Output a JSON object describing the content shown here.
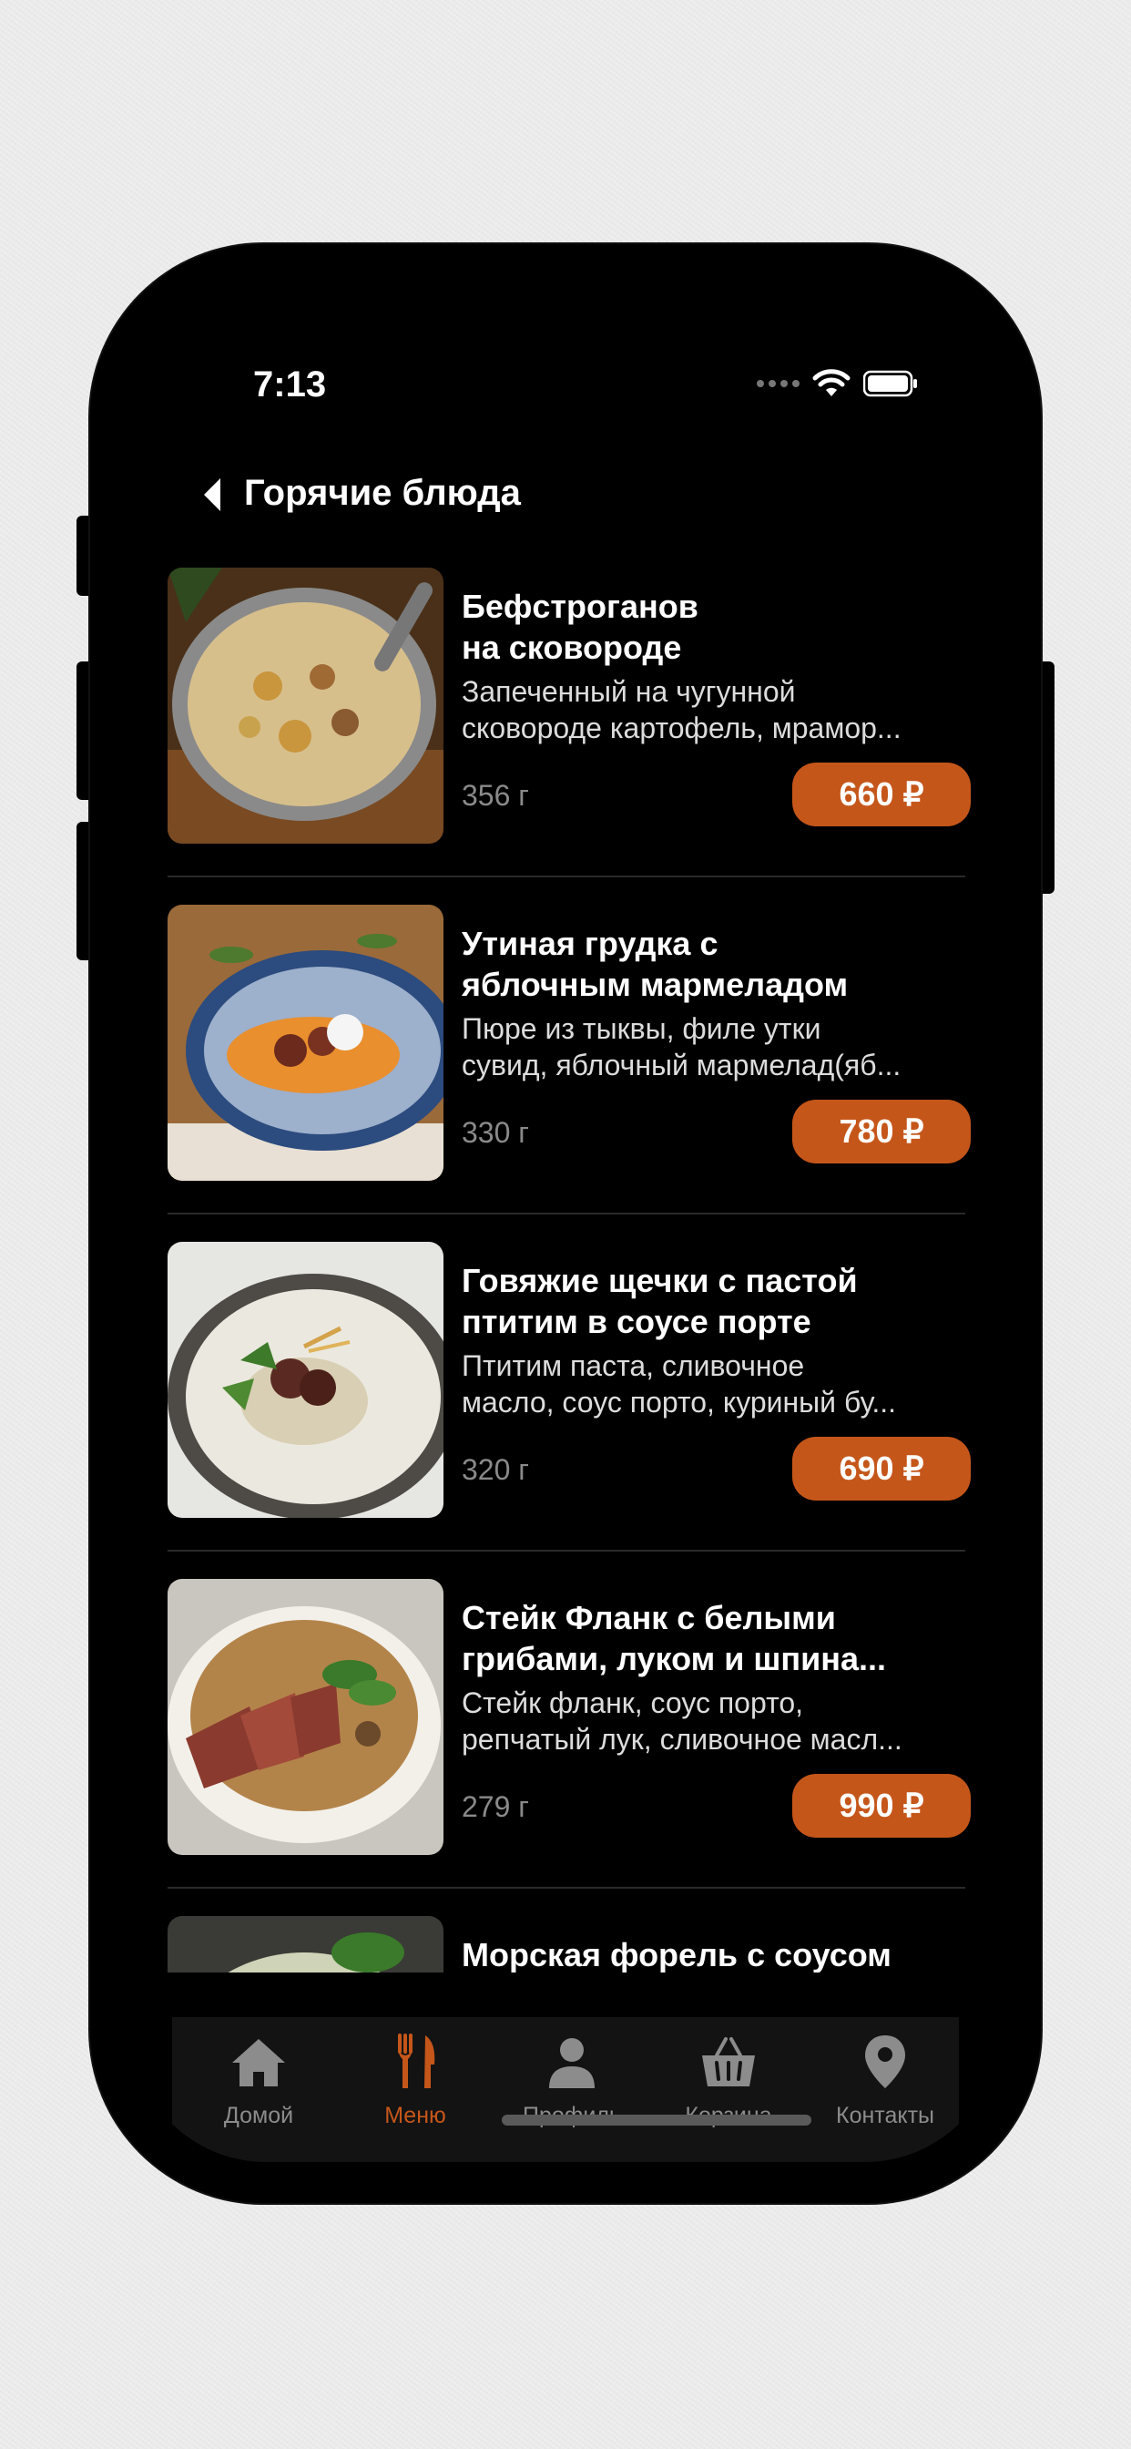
{
  "status_bar": {
    "time": "7:13"
  },
  "header": {
    "title": "Горячие блюда"
  },
  "menu_items": [
    {
      "name": "Бефстроганов\nна сковороде",
      "description": "Запеченный на чугунной\nсковороде картофель, мрамор...",
      "weight": "356 г",
      "price": "660 ₽"
    },
    {
      "name": "Утиная грудка с\nяблочным мармеладом",
      "description": "Пюре из тыквы, филе утки\nсувид, яблочный мармелад(яб...",
      "weight": "330 г",
      "price": "780 ₽"
    },
    {
      "name": "Говяжие щечки с пастой\nптитим в соусе порте",
      "description": "Птитим паста, сливочное\nмасло, соус порто, куриный бу...",
      "weight": "320 г",
      "price": "690 ₽"
    },
    {
      "name": "Стейк Фланк с белыми\nгрибами, луком и шпина...",
      "description": "Стейк фланк, соус порто,\nрепчатый лук, сливочное масл...",
      "weight": "279 г",
      "price": "990 ₽"
    },
    {
      "name": "Морская форель с соусом",
      "description": "",
      "weight": "",
      "price": ""
    }
  ],
  "tab_bar": {
    "tabs": [
      {
        "label": "Домой",
        "icon": "home-icon"
      },
      {
        "label": "Меню",
        "icon": "fork-knife-icon",
        "active": true
      },
      {
        "label": "Профиль",
        "icon": "user-icon"
      },
      {
        "label": "Корзина",
        "icon": "basket-icon"
      },
      {
        "label": "Контакты",
        "icon": "location-pin-icon"
      }
    ]
  },
  "colors": {
    "accent": "#c5561a",
    "background": "#000000",
    "tab_bar": "#131313",
    "inactive": "#8c8c8c"
  }
}
